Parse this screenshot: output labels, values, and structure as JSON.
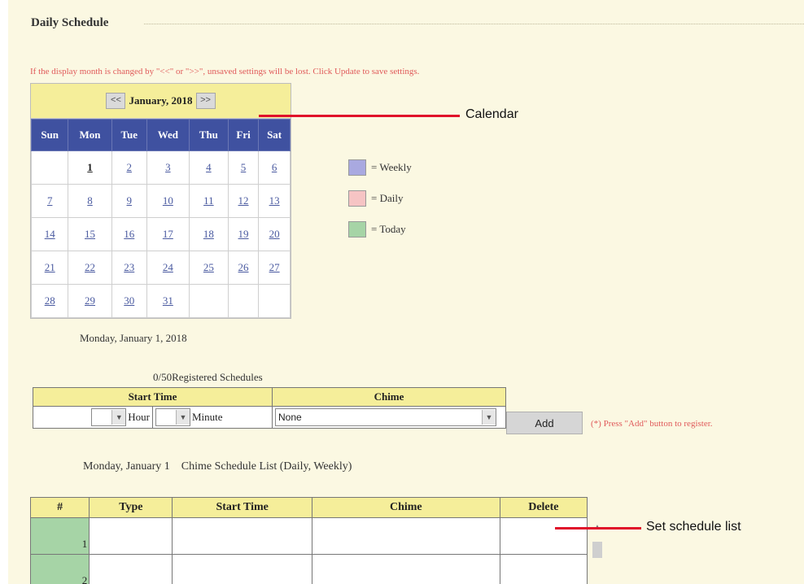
{
  "section": {
    "title": "Daily Schedule"
  },
  "warning": "If the display month is changed by \"<<\" or \">>\", unsaved settings will be lost. Click Update to save settings.",
  "calendar": {
    "prev_label": "<<",
    "next_label": ">>",
    "month_label": "January, 2018",
    "weekdays": [
      "Sun",
      "Mon",
      "Tue",
      "Wed",
      "Thu",
      "Fri",
      "Sat"
    ],
    "weeks": [
      [
        "",
        "1",
        "2",
        "3",
        "4",
        "5",
        "6"
      ],
      [
        "7",
        "8",
        "9",
        "10",
        "11",
        "12",
        "13"
      ],
      [
        "14",
        "15",
        "16",
        "17",
        "18",
        "19",
        "20"
      ],
      [
        "21",
        "22",
        "23",
        "24",
        "25",
        "26",
        "27"
      ],
      [
        "28",
        "29",
        "30",
        "31",
        "",
        "",
        ""
      ]
    ],
    "today": "1",
    "selected_date": "Monday, January 1, 2018"
  },
  "legend": [
    {
      "label": "= Weekly",
      "color": "#a9a9e0"
    },
    {
      "label": "= Daily",
      "color": "#f6c4c4"
    },
    {
      "label": "= Today",
      "color": "#a6d4a6"
    }
  ],
  "callouts": {
    "calendar": "Calendar",
    "list": "Set schedule list"
  },
  "registration": {
    "count": "0/50Registered Schedules",
    "start_time_header": "Start Time",
    "chime_header": "Chime",
    "hour_value": "",
    "hour_label": "Hour",
    "minute_value": "",
    "minute_label": "Minute",
    "chime_value": "None",
    "add_label": "Add",
    "note": "(*) Press \"Add\" button to register."
  },
  "list": {
    "title": "Monday, January 1    Chime Schedule List (Daily, Weekly)",
    "headers": [
      "#",
      "Type",
      "Start Time",
      "Chime",
      "Delete"
    ],
    "rows": [
      {
        "index": "1",
        "type": "",
        "start_time": "",
        "chime": "",
        "delete": ""
      },
      {
        "index": "2",
        "type": "",
        "start_time": "",
        "chime": "",
        "delete": ""
      }
    ]
  },
  "colors": {
    "accent_red": "#e0102a",
    "header_blue": "#3f51a0",
    "header_yellow": "#f5ee9a",
    "today_green": "#a6d4a6"
  }
}
